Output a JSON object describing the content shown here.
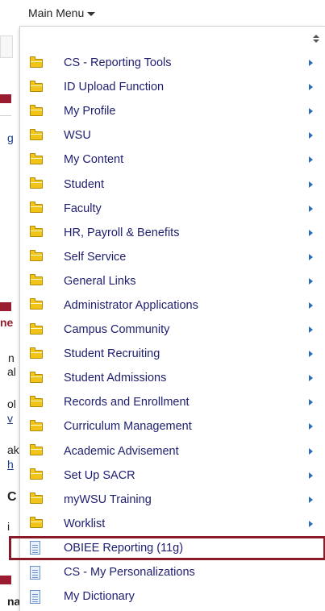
{
  "header": {
    "main_menu_label": "Main Menu"
  },
  "background_fragments": {
    "frag_g": "g",
    "frag_ne": "ne",
    "frag_n": "n",
    "frag_al": "al",
    "frag_ol": "ol",
    "frag_v": "v",
    "frag_ak": "ak",
    "frag_h": "h",
    "frag_c": "C",
    "frag_i": "i",
    "frag_na": "na"
  },
  "menu": {
    "items": [
      {
        "label": "CS - Reporting Tools",
        "icon": "folder-icon",
        "has_submenu": true
      },
      {
        "label": "ID Upload Function",
        "icon": "folder-icon",
        "has_submenu": true
      },
      {
        "label": "My Profile",
        "icon": "folder-icon",
        "has_submenu": true
      },
      {
        "label": "WSU",
        "icon": "folder-icon",
        "has_submenu": true
      },
      {
        "label": "My Content",
        "icon": "folder-icon",
        "has_submenu": true
      },
      {
        "label": "Student",
        "icon": "folder-icon",
        "has_submenu": true
      },
      {
        "label": "Faculty",
        "icon": "folder-icon",
        "has_submenu": true
      },
      {
        "label": "HR, Payroll & Benefits",
        "icon": "folder-icon",
        "has_submenu": true
      },
      {
        "label": "Self Service",
        "icon": "folder-icon",
        "has_submenu": true
      },
      {
        "label": "General Links",
        "icon": "folder-icon",
        "has_submenu": true
      },
      {
        "label": "Administrator Applications",
        "icon": "folder-icon",
        "has_submenu": true
      },
      {
        "label": "Campus Community",
        "icon": "folder-icon",
        "has_submenu": true
      },
      {
        "label": "Student Recruiting",
        "icon": "folder-icon",
        "has_submenu": true
      },
      {
        "label": "Student Admissions",
        "icon": "folder-icon",
        "has_submenu": true
      },
      {
        "label": "Records and Enrollment",
        "icon": "folder-icon",
        "has_submenu": true
      },
      {
        "label": "Curriculum Management",
        "icon": "folder-icon",
        "has_submenu": true
      },
      {
        "label": "Academic Advisement",
        "icon": "folder-icon",
        "has_submenu": true
      },
      {
        "label": "Set Up SACR",
        "icon": "folder-icon",
        "has_submenu": true
      },
      {
        "label": "myWSU Training",
        "icon": "folder-icon",
        "has_submenu": true
      },
      {
        "label": "Worklist",
        "icon": "folder-icon",
        "has_submenu": true
      },
      {
        "label": "OBIEE Reporting (11g)",
        "icon": "document-icon",
        "has_submenu": false,
        "highlighted": true
      },
      {
        "label": "CS - My Personalizations",
        "icon": "document-icon",
        "has_submenu": false
      },
      {
        "label": "My Dictionary",
        "icon": "document-icon",
        "has_submenu": false
      }
    ]
  },
  "colors": {
    "highlight_border": "#8b1a28",
    "brand_bar": "#9b1b30",
    "link_text": "#1e1e6e",
    "submenu_arrow": "#2a6ebb"
  }
}
